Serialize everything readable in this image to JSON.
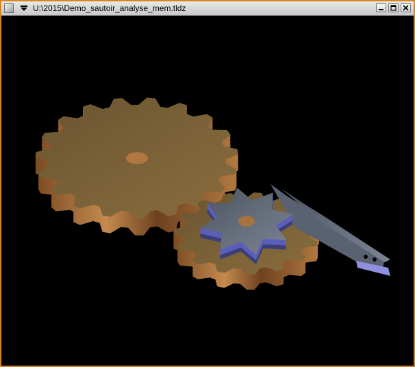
{
  "window": {
    "title": "U:\\2015\\Demo_sautoir_analyse_mem.tldz",
    "icons": [
      "app-icon",
      "menu-arrow-icon",
      "minimize-icon",
      "maximize-icon",
      "close-icon"
    ],
    "border_color": "#d9851c"
  },
  "scene": {
    "background": "#000000",
    "objects": [
      "large-gear",
      "small-gear",
      "star-wheel",
      "pawl-lever"
    ],
    "colors": {
      "gear_bronze": "#a8773c",
      "metal_blue": "#6f7c9a"
    }
  }
}
